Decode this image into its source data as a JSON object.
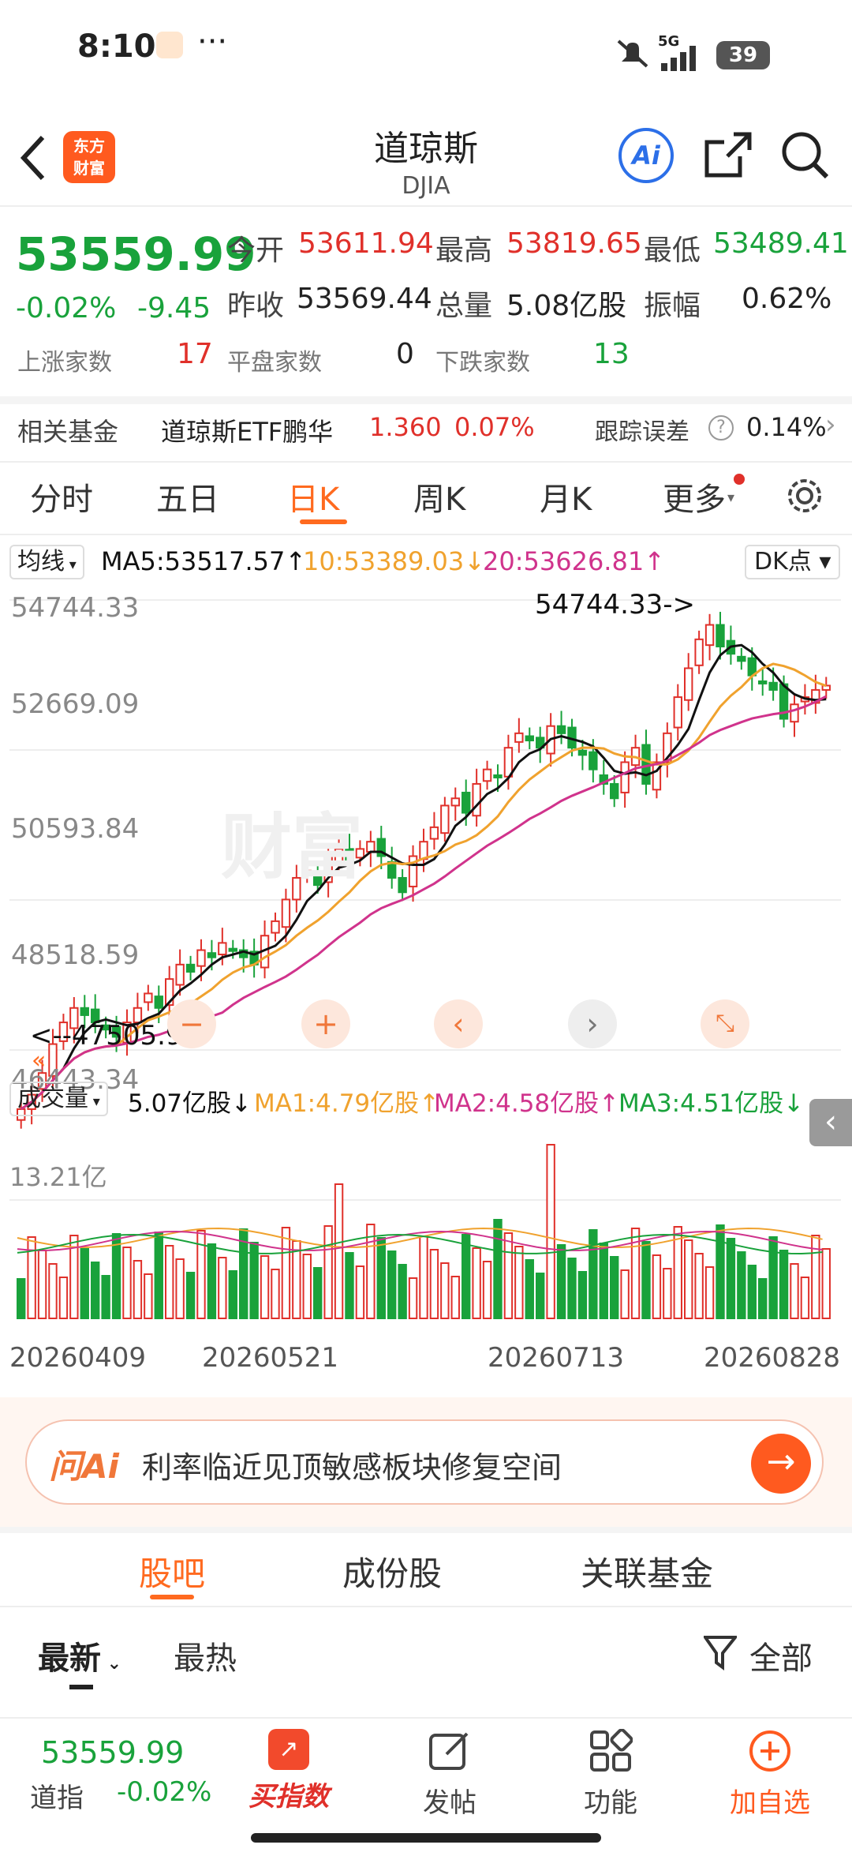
{
  "status_bar": {
    "time": "8:10",
    "dots": "···",
    "network": "5G",
    "battery": "39"
  },
  "header": {
    "title": "道琼斯",
    "subtitle": "DJIA",
    "logo_line1": "东方",
    "logo_line2": "财富",
    "ai_label": "Ai"
  },
  "quote": {
    "price": "53559.99",
    "change_pct": "-0.02%",
    "change": "-9.45",
    "open_label": "今开",
    "open": "53611.94",
    "high_label": "最高",
    "high": "53819.65",
    "low_label": "最低",
    "low": "53489.41",
    "prev_close_label": "昨收",
    "prev_close": "53569.44",
    "volume_label": "总量",
    "volume": "5.08亿股",
    "amplitude_label": "振幅",
    "amplitude": "0.62%",
    "up_label": "上涨家数",
    "up": "17",
    "flat_label": "平盘家数",
    "flat": "0",
    "down_label": "下跌家数",
    "down": "13"
  },
  "fund": {
    "label": "相关基金",
    "name": "道琼斯ETF鹏华",
    "price": "1.360",
    "pct": "0.07%",
    "track_label": "跟踪误差",
    "track": "0.14%"
  },
  "tabs": [
    "分时",
    "五日",
    "日K",
    "周K",
    "月K",
    "更多"
  ],
  "colors": {
    "accent": "#ff6a1f",
    "up": "#e0302a",
    "down": "#19a23b",
    "ma5": "#111111",
    "ma10": "#f0a22e",
    "ma20": "#d0338c"
  },
  "ma_legend": {
    "selector": "均线",
    "ma5": "MA5:53517.57",
    "ma10": "10:53389.03",
    "ma20": "20:53626.81",
    "dk": "DK点"
  },
  "price_axis": [
    "54744.33",
    "52669.09",
    "50593.84",
    "48518.59",
    "46443.34"
  ],
  "annotations": {
    "high": "54744.33->",
    "low": "<--47505.97"
  },
  "vol_legend": {
    "selector": "成交量",
    "vol": "5.07亿股",
    "ma1": "MA1:4.79亿股",
    "ma2": "MA2:4.58亿股",
    "ma3": "MA3:4.51亿股",
    "max": "13.21亿"
  },
  "dates": [
    "20260409",
    "20260521",
    "20260713",
    "20260828"
  ],
  "chart_data": {
    "type": "candlestick",
    "ylim": [
      46443.34,
      54744.33
    ],
    "close": [
      47700,
      47900,
      48200,
      48600,
      48900,
      49100,
      49000,
      48900,
      48800,
      48700,
      48900,
      49100,
      49300,
      49100,
      49500,
      49700,
      49600,
      49900,
      49800,
      50000,
      49900,
      49800,
      49700,
      50100,
      50300,
      50600,
      50900,
      51000,
      50800,
      51200,
      51300,
      51100,
      51300,
      51400,
      51200,
      50900,
      50700,
      51200,
      51400,
      51600,
      51900,
      52000,
      51800,
      52200,
      52400,
      52300,
      52700,
      52900,
      52800,
      52700,
      53000,
      52900,
      52700,
      52600,
      52400,
      52200,
      52000,
      52500,
      52700,
      52200,
      52500,
      52900,
      53400,
      53800,
      54200,
      54400,
      54100,
      54000,
      53900,
      53700,
      53600,
      53500,
      53100,
      53300,
      53400,
      53500,
      53560
    ],
    "ma_note": "MA5/MA10/MA20 overlays"
  },
  "ai_bar": {
    "brand": "问Ai",
    "text": "利率临近见顶敏感板块修复空间"
  },
  "sub_tabs": [
    "股吧",
    "成份股",
    "关联基金"
  ],
  "sort": {
    "latest": "最新",
    "hot": "最热",
    "filter": "全部"
  },
  "bottom_bar": {
    "price": "53559.99",
    "name": "道指",
    "pct": "-0.02%",
    "buy": "买指数",
    "post": "发帖",
    "func": "功能",
    "add": "加自选"
  }
}
